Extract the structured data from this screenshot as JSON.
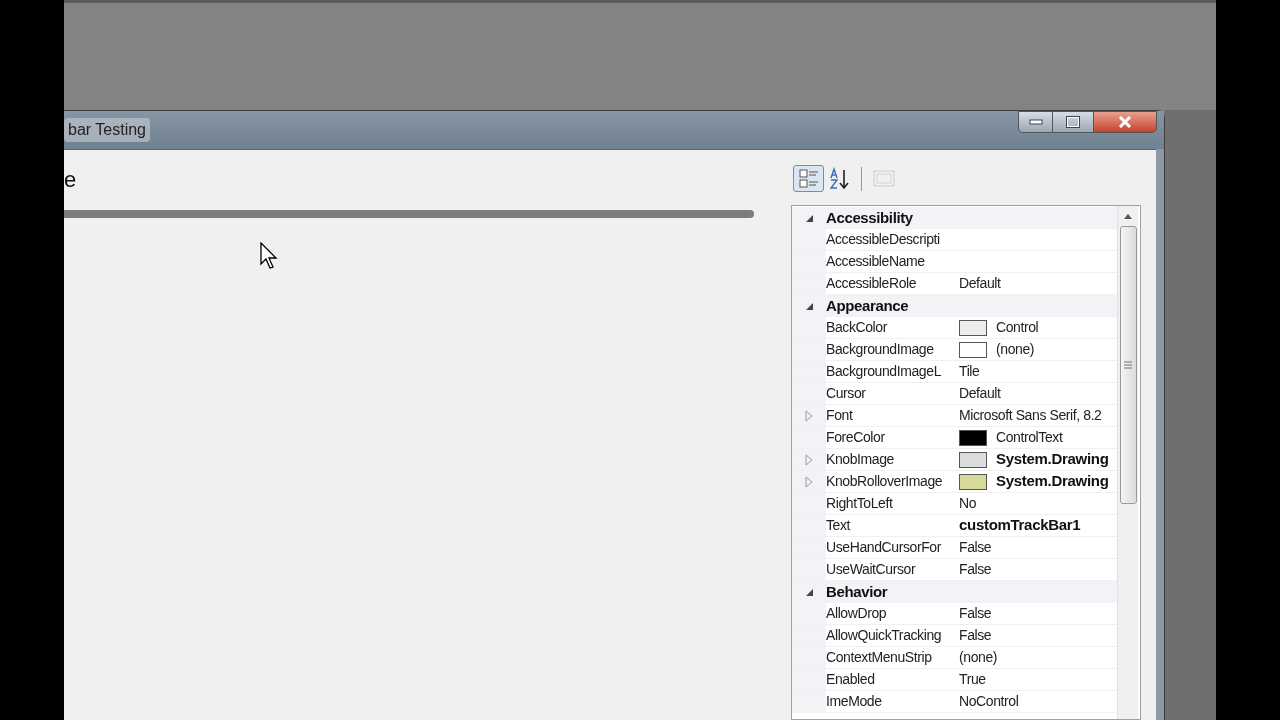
{
  "window": {
    "title": "bar Testing",
    "heading": "e"
  },
  "toolbar": [
    {
      "kind": "categorized",
      "selected": true,
      "disabled": false
    },
    {
      "kind": "alphabetical",
      "selected": false,
      "disabled": false
    },
    {
      "kind": "pages",
      "selected": false,
      "disabled": true
    }
  ],
  "properties": [
    {
      "kind": "category",
      "name": "Accessibility",
      "expanded": true
    },
    {
      "kind": "property",
      "name": "AccessibleDescripti",
      "expandable": false
    },
    {
      "kind": "property",
      "name": "AccessibleName",
      "expandable": false
    },
    {
      "kind": "property",
      "name": "AccessibleRole",
      "value": "Default",
      "expandable": false,
      "modified": false
    },
    {
      "kind": "category",
      "name": "Appearance",
      "expanded": true
    },
    {
      "kind": "property",
      "name": "BackColor",
      "value": "Control",
      "color": "#ececec",
      "expandable": false,
      "modified": false
    },
    {
      "kind": "property",
      "name": "BackgroundImage",
      "value": "(none)",
      "color": "#ffffff",
      "expandable": false,
      "modified": false
    },
    {
      "kind": "property",
      "name": "BackgroundImageL",
      "value": "Tile",
      "expandable": false,
      "modified": false
    },
    {
      "kind": "property",
      "name": "Cursor",
      "value": "Default",
      "expandable": false,
      "modified": false
    },
    {
      "kind": "property",
      "name": "Font",
      "value": "Microsoft Sans Serif, 8.2",
      "expandable": true,
      "modified": false
    },
    {
      "kind": "property",
      "name": "ForeColor",
      "value": "ControlText",
      "color": "#000000",
      "expandable": false,
      "modified": false
    },
    {
      "kind": "property",
      "name": "KnobImage",
      "value": "System.Drawing",
      "color": "#dcdcdc",
      "expandable": true,
      "modified": true
    },
    {
      "kind": "property",
      "name": "KnobRolloverImage",
      "value": "System.Drawing",
      "color": "#d6d99a",
      "expandable": true,
      "modified": true
    },
    {
      "kind": "property",
      "name": "RightToLeft",
      "value": "No",
      "expandable": false,
      "modified": false
    },
    {
      "kind": "property",
      "name": "Text",
      "value": "customTrackBar1",
      "expandable": false,
      "modified": true
    },
    {
      "kind": "property",
      "name": "UseHandCursorFor",
      "value": "False",
      "expandable": false,
      "modified": false
    },
    {
      "kind": "property",
      "name": "UseWaitCursor",
      "value": "False",
      "expandable": false,
      "modified": false
    },
    {
      "kind": "category",
      "name": "Behavior",
      "expanded": true
    },
    {
      "kind": "property",
      "name": "AllowDrop",
      "value": "False",
      "expandable": false,
      "modified": false
    },
    {
      "kind": "property",
      "name": "AllowQuickTracking",
      "value": "False",
      "expandable": false,
      "modified": false
    },
    {
      "kind": "property",
      "name": "ContextMenuStrip",
      "value": "(none)",
      "expandable": false,
      "modified": false
    },
    {
      "kind": "property",
      "name": "Enabled",
      "value": "True",
      "expandable": false,
      "modified": false
    },
    {
      "kind": "property",
      "name": "ImeMode",
      "value": "NoControl",
      "expandable": false,
      "modified": false
    }
  ]
}
